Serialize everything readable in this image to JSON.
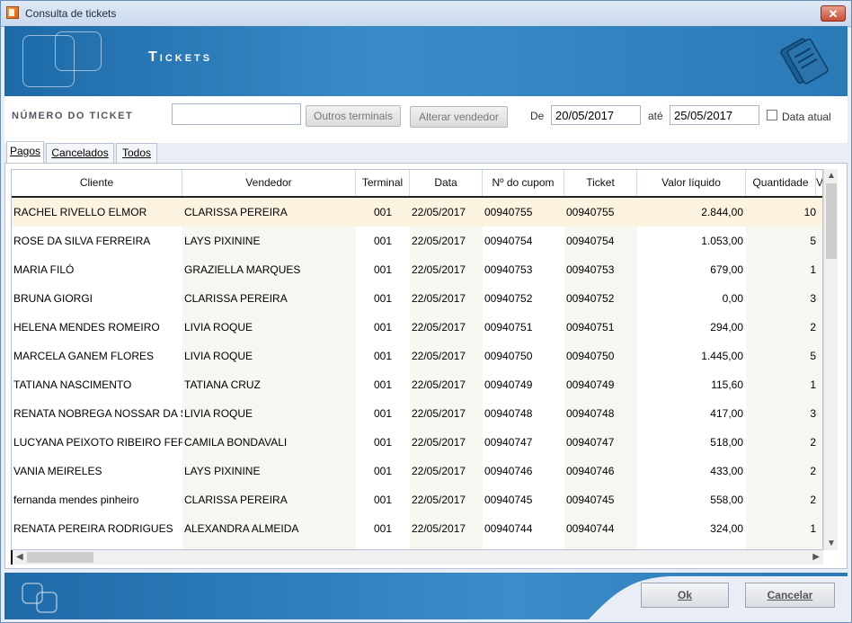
{
  "window": {
    "title": "Consulta de tickets",
    "close_label": "✕"
  },
  "banner": {
    "title": "Tickets"
  },
  "filter": {
    "ticket_number_label": "NÚMERO DO TICKET",
    "ticket_number_value": "",
    "outros_terminais_label": "Outros terminais",
    "alterar_vendedor_label": "Alterar vendedor",
    "de_label": "De",
    "date_from": "20/05/2017",
    "ate_label": "até",
    "date_to": "25/05/2017",
    "data_atual_label": "Data atual",
    "data_atual_checked": false
  },
  "tabs": [
    {
      "label": "Pagos",
      "active": true
    },
    {
      "label": "Cancelados",
      "active": false
    },
    {
      "label": "Todos",
      "active": false
    }
  ],
  "grid": {
    "columns": [
      "Cliente",
      "Vendedor",
      "Terminal",
      "Data",
      "Nº do cupom",
      "Ticket",
      "Valor líquido",
      "Quantidade",
      "V"
    ],
    "rows": [
      [
        "RACHEL RIVELLO ELMOR",
        "CLARISSA PEREIRA",
        "001",
        "22/05/2017",
        "00940755",
        "00940755",
        "2.844,00",
        "10"
      ],
      [
        "ROSE DA SILVA FERREIRA",
        "LAYS PIXININE",
        "001",
        "22/05/2017",
        "00940754",
        "00940754",
        "1.053,00",
        "5"
      ],
      [
        "MARIA FILÓ",
        "GRAZIELLA MARQUES",
        "001",
        "22/05/2017",
        "00940753",
        "00940753",
        "679,00",
        "1"
      ],
      [
        "BRUNA GIORGI",
        "CLARISSA PEREIRA",
        "001",
        "22/05/2017",
        "00940752",
        "00940752",
        "0,00",
        "3"
      ],
      [
        "HELENA MENDES ROMEIRO",
        "LIVIA ROQUE",
        "001",
        "22/05/2017",
        "00940751",
        "00940751",
        "294,00",
        "2"
      ],
      [
        "MARCELA GANEM FLORES",
        "LIVIA ROQUE",
        "001",
        "22/05/2017",
        "00940750",
        "00940750",
        "1.445,00",
        "5"
      ],
      [
        "TATIANA NASCIMENTO",
        "TATIANA CRUZ",
        "001",
        "22/05/2017",
        "00940749",
        "00940749",
        "115,60",
        "1"
      ],
      [
        "RENATA NOBREGA NOSSAR DA S",
        "LIVIA ROQUE",
        "001",
        "22/05/2017",
        "00940748",
        "00940748",
        "417,00",
        "3"
      ],
      [
        "LUCYANA PEIXOTO RIBEIRO FERI",
        "CAMILA BONDAVALI",
        "001",
        "22/05/2017",
        "00940747",
        "00940747",
        "518,00",
        "2"
      ],
      [
        "VANIA MEIRELES",
        "LAYS PIXININE",
        "001",
        "22/05/2017",
        "00940746",
        "00940746",
        "433,00",
        "2"
      ],
      [
        "fernanda mendes pinheiro",
        "CLARISSA PEREIRA",
        "001",
        "22/05/2017",
        "00940745",
        "00940745",
        "558,00",
        "2"
      ],
      [
        "RENATA PEREIRA RODRIGUES",
        "ALEXANDRA ALMEIDA",
        "001",
        "22/05/2017",
        "00940744",
        "00940744",
        "324,00",
        "1"
      ]
    ]
  },
  "footer": {
    "ok_label": "Ok",
    "cancel_label": "Cancelar"
  }
}
